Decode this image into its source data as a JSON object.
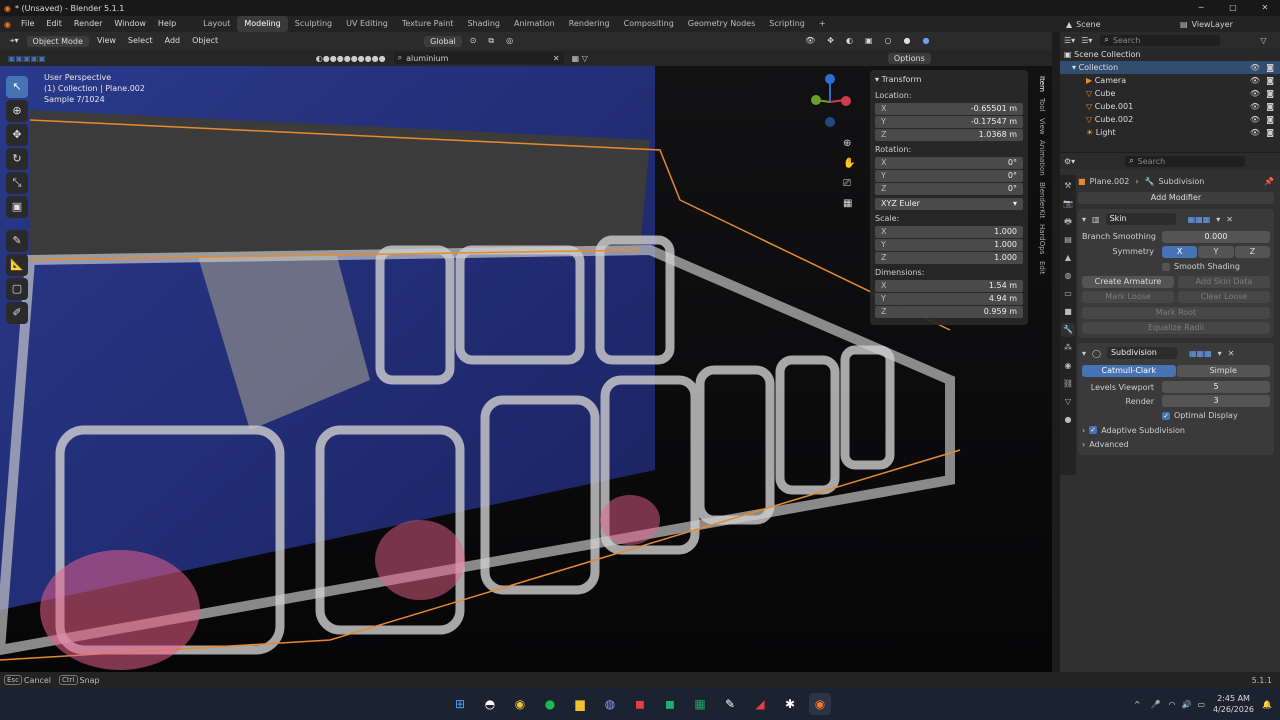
{
  "window": {
    "title": "* (Unsaved) - Blender 5.1.1",
    "version": "5.1.1"
  },
  "menu": [
    "File",
    "Edit",
    "Render",
    "Window",
    "Help"
  ],
  "workspaces": [
    "Layout",
    "Modeling",
    "Sculpting",
    "UV Editing",
    "Texture Paint",
    "Shading",
    "Animation",
    "Rendering",
    "Compositing",
    "Geometry Nodes",
    "Scripting"
  ],
  "active_workspace": "Modeling",
  "scene": "Scene",
  "view_layer": "ViewLayer",
  "viewport_header": {
    "mode": "Object Mode",
    "menus": [
      "View",
      "Select",
      "Add",
      "Object"
    ],
    "orientation": "Global",
    "options": "Options",
    "search_value": "aluminium"
  },
  "viewport_info": {
    "line1": "User Perspective",
    "line2": "(1) Collection | Plane.002",
    "line3": "Sample 7/1024"
  },
  "transform_panel": {
    "title": "Transform",
    "location_label": "Location:",
    "location": {
      "x": "-0.65501 m",
      "y": "-0.17547 m",
      "z": "1.0368 m"
    },
    "rotation_label": "Rotation:",
    "rotation": {
      "x": "0°",
      "y": "0°",
      "z": "0°"
    },
    "rotation_mode": "XYZ Euler",
    "scale_label": "Scale:",
    "scale": {
      "x": "1.000",
      "y": "1.000",
      "z": "1.000"
    },
    "dimensions_label": "Dimensions:",
    "dimensions": {
      "x": "1.54 m",
      "y": "4.94 m",
      "z": "0.959 m"
    }
  },
  "side_tabs": [
    "Item",
    "Tool",
    "View",
    "Animation",
    "BlenderKit",
    "HardOps",
    "Edit"
  ],
  "outliner": {
    "root": "Scene Collection",
    "collection": "Collection",
    "items": [
      "Camera",
      "Cube",
      "Cube.001",
      "Cube.002",
      "Light"
    ]
  },
  "properties": {
    "search_placeholder": "Search",
    "breadcrumb_object": "Plane.002",
    "breadcrumb_modifier": "Subdivision",
    "add_modifier": "Add Modifier",
    "skin": {
      "name": "Skin",
      "branch_smoothing_label": "Branch Smoothing",
      "branch_smoothing": "0.000",
      "symmetry_label": "Symmetry",
      "symmetry_axes": [
        "X",
        "Y",
        "Z"
      ],
      "smooth_shading": "Smooth Shading",
      "create_armature": "Create Armature",
      "add_skin_data": "Add Skin Data",
      "mark_loose": "Mark Loose",
      "clear_loose": "Clear Loose",
      "mark_root": "Mark Root",
      "equalize_radii": "Equalize Radii"
    },
    "subdivision": {
      "name": "Subdivision",
      "type_options": [
        "Catmull-Clark",
        "Simple"
      ],
      "levels_viewport_label": "Levels Viewport",
      "levels_viewport": "5",
      "render_label": "Render",
      "render": "3",
      "optimal_display": "Optimal Display",
      "adaptive": "Adaptive Subdivision",
      "advanced": "Advanced"
    }
  },
  "status": {
    "cancel_key": "Esc",
    "cancel": "Cancel",
    "snap_key": "Ctrl",
    "snap": "Snap",
    "version": "5.1.1"
  },
  "taskbar": {
    "time": "2:45 AM",
    "date": "4/26/2026"
  }
}
